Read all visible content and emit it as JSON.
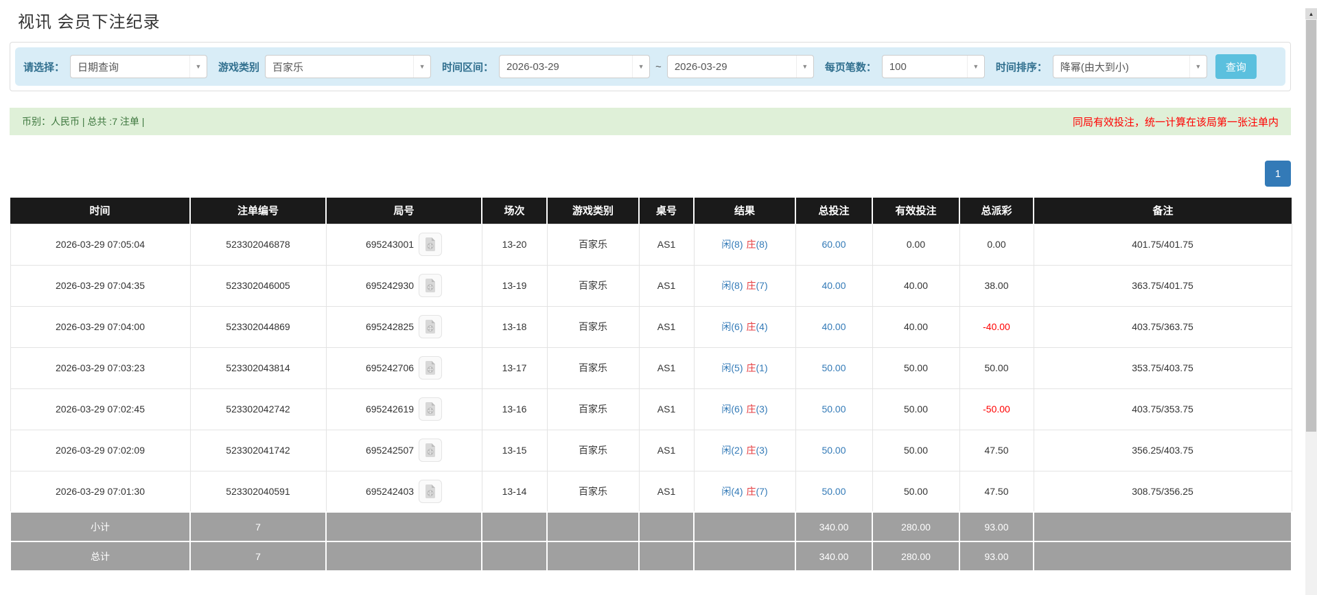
{
  "page": {
    "title": "视讯 会员下注纪录"
  },
  "filters": {
    "select_label": "请选择：",
    "query_type_value": "日期查询",
    "game_type_label": "游戏类别",
    "game_type_value": "百家乐",
    "date_range_label": "时间区间：",
    "date_from": "2026-03-29",
    "tilde": "~",
    "date_to": "2026-03-29",
    "per_page_label": "每页笔数：",
    "per_page_value": "100",
    "sort_label": "时间排序：",
    "sort_value": "降幂(由大到小)",
    "search_button": "查询",
    "caret": "▼"
  },
  "summary": {
    "left": "币别：人民币 | 总共 :7 注单 |",
    "right": "同局有效投注，统一计算在该局第一张注单内"
  },
  "pagination": {
    "current": "1"
  },
  "table": {
    "headers": [
      "时间",
      "注单编号",
      "局号",
      "场次",
      "游戏类别",
      "桌号",
      "结果",
      "总投注",
      "有效投注",
      "总派彩",
      "备注"
    ],
    "rows": [
      {
        "time": "2026-03-29 07:05:04",
        "bet_id": "523302046878",
        "round_id": "695243001",
        "session": "13-20",
        "game": "百家乐",
        "table_no": "AS1",
        "result_player": "闲(8)",
        "result_banker_char": "庄",
        "result_banker_num": "(8)",
        "total_bet": "60.00",
        "valid_bet": "0.00",
        "payout": "0.00",
        "payout_negative": false,
        "note": "401.75/401.75"
      },
      {
        "time": "2026-03-29 07:04:35",
        "bet_id": "523302046005",
        "round_id": "695242930",
        "session": "13-19",
        "game": "百家乐",
        "table_no": "AS1",
        "result_player": "闲(8)",
        "result_banker_char": "庄",
        "result_banker_num": "(7)",
        "total_bet": "40.00",
        "valid_bet": "40.00",
        "payout": "38.00",
        "payout_negative": false,
        "note": "363.75/401.75"
      },
      {
        "time": "2026-03-29 07:04:00",
        "bet_id": "523302044869",
        "round_id": "695242825",
        "session": "13-18",
        "game": "百家乐",
        "table_no": "AS1",
        "result_player": "闲(6)",
        "result_banker_char": "庄",
        "result_banker_num": "(4)",
        "total_bet": "40.00",
        "valid_bet": "40.00",
        "payout": "-40.00",
        "payout_negative": true,
        "note": "403.75/363.75"
      },
      {
        "time": "2026-03-29 07:03:23",
        "bet_id": "523302043814",
        "round_id": "695242706",
        "session": "13-17",
        "game": "百家乐",
        "table_no": "AS1",
        "result_player": "闲(5)",
        "result_banker_char": "庄",
        "result_banker_num": "(1)",
        "total_bet": "50.00",
        "valid_bet": "50.00",
        "payout": "50.00",
        "payout_negative": false,
        "note": "353.75/403.75"
      },
      {
        "time": "2026-03-29 07:02:45",
        "bet_id": "523302042742",
        "round_id": "695242619",
        "session": "13-16",
        "game": "百家乐",
        "table_no": "AS1",
        "result_player": "闲(6)",
        "result_banker_char": "庄",
        "result_banker_num": "(3)",
        "total_bet": "50.00",
        "valid_bet": "50.00",
        "payout": "-50.00",
        "payout_negative": true,
        "note": "403.75/353.75"
      },
      {
        "time": "2026-03-29 07:02:09",
        "bet_id": "523302041742",
        "round_id": "695242507",
        "session": "13-15",
        "game": "百家乐",
        "table_no": "AS1",
        "result_player": "闲(2)",
        "result_banker_char": "庄",
        "result_banker_num": "(3)",
        "total_bet": "50.00",
        "valid_bet": "50.00",
        "payout": "47.50",
        "payout_negative": false,
        "note": "356.25/403.75"
      },
      {
        "time": "2026-03-29 07:01:30",
        "bet_id": "523302040591",
        "round_id": "695242403",
        "session": "13-14",
        "game": "百家乐",
        "table_no": "AS1",
        "result_player": "闲(4)",
        "result_banker_char": "庄",
        "result_banker_num": "(7)",
        "total_bet": "50.00",
        "valid_bet": "50.00",
        "payout": "47.50",
        "payout_negative": false,
        "note": "308.75/356.25"
      }
    ],
    "subtotal": {
      "label": "小计",
      "count": "7",
      "total_bet": "340.00",
      "valid_bet": "280.00",
      "payout": "93.00"
    },
    "total": {
      "label": "总计",
      "count": "7",
      "total_bet": "340.00",
      "valid_bet": "280.00",
      "payout": "93.00"
    }
  },
  "colors": {
    "filter_bar_bg": "#d9edf7",
    "filter_label": "#31708f",
    "query_button": "#5bc0de",
    "summary_bg": "#dff0d8",
    "summary_text": "#3c763d",
    "notice_red": "#ff0000",
    "pagination_blue": "#337ab7",
    "header_bg": "#1a1a1a",
    "player_blue": "#337ab7",
    "banker_red": "#e4393c",
    "negative_red": "#ff0000",
    "sum_row_bg": "#a0a0a0"
  }
}
